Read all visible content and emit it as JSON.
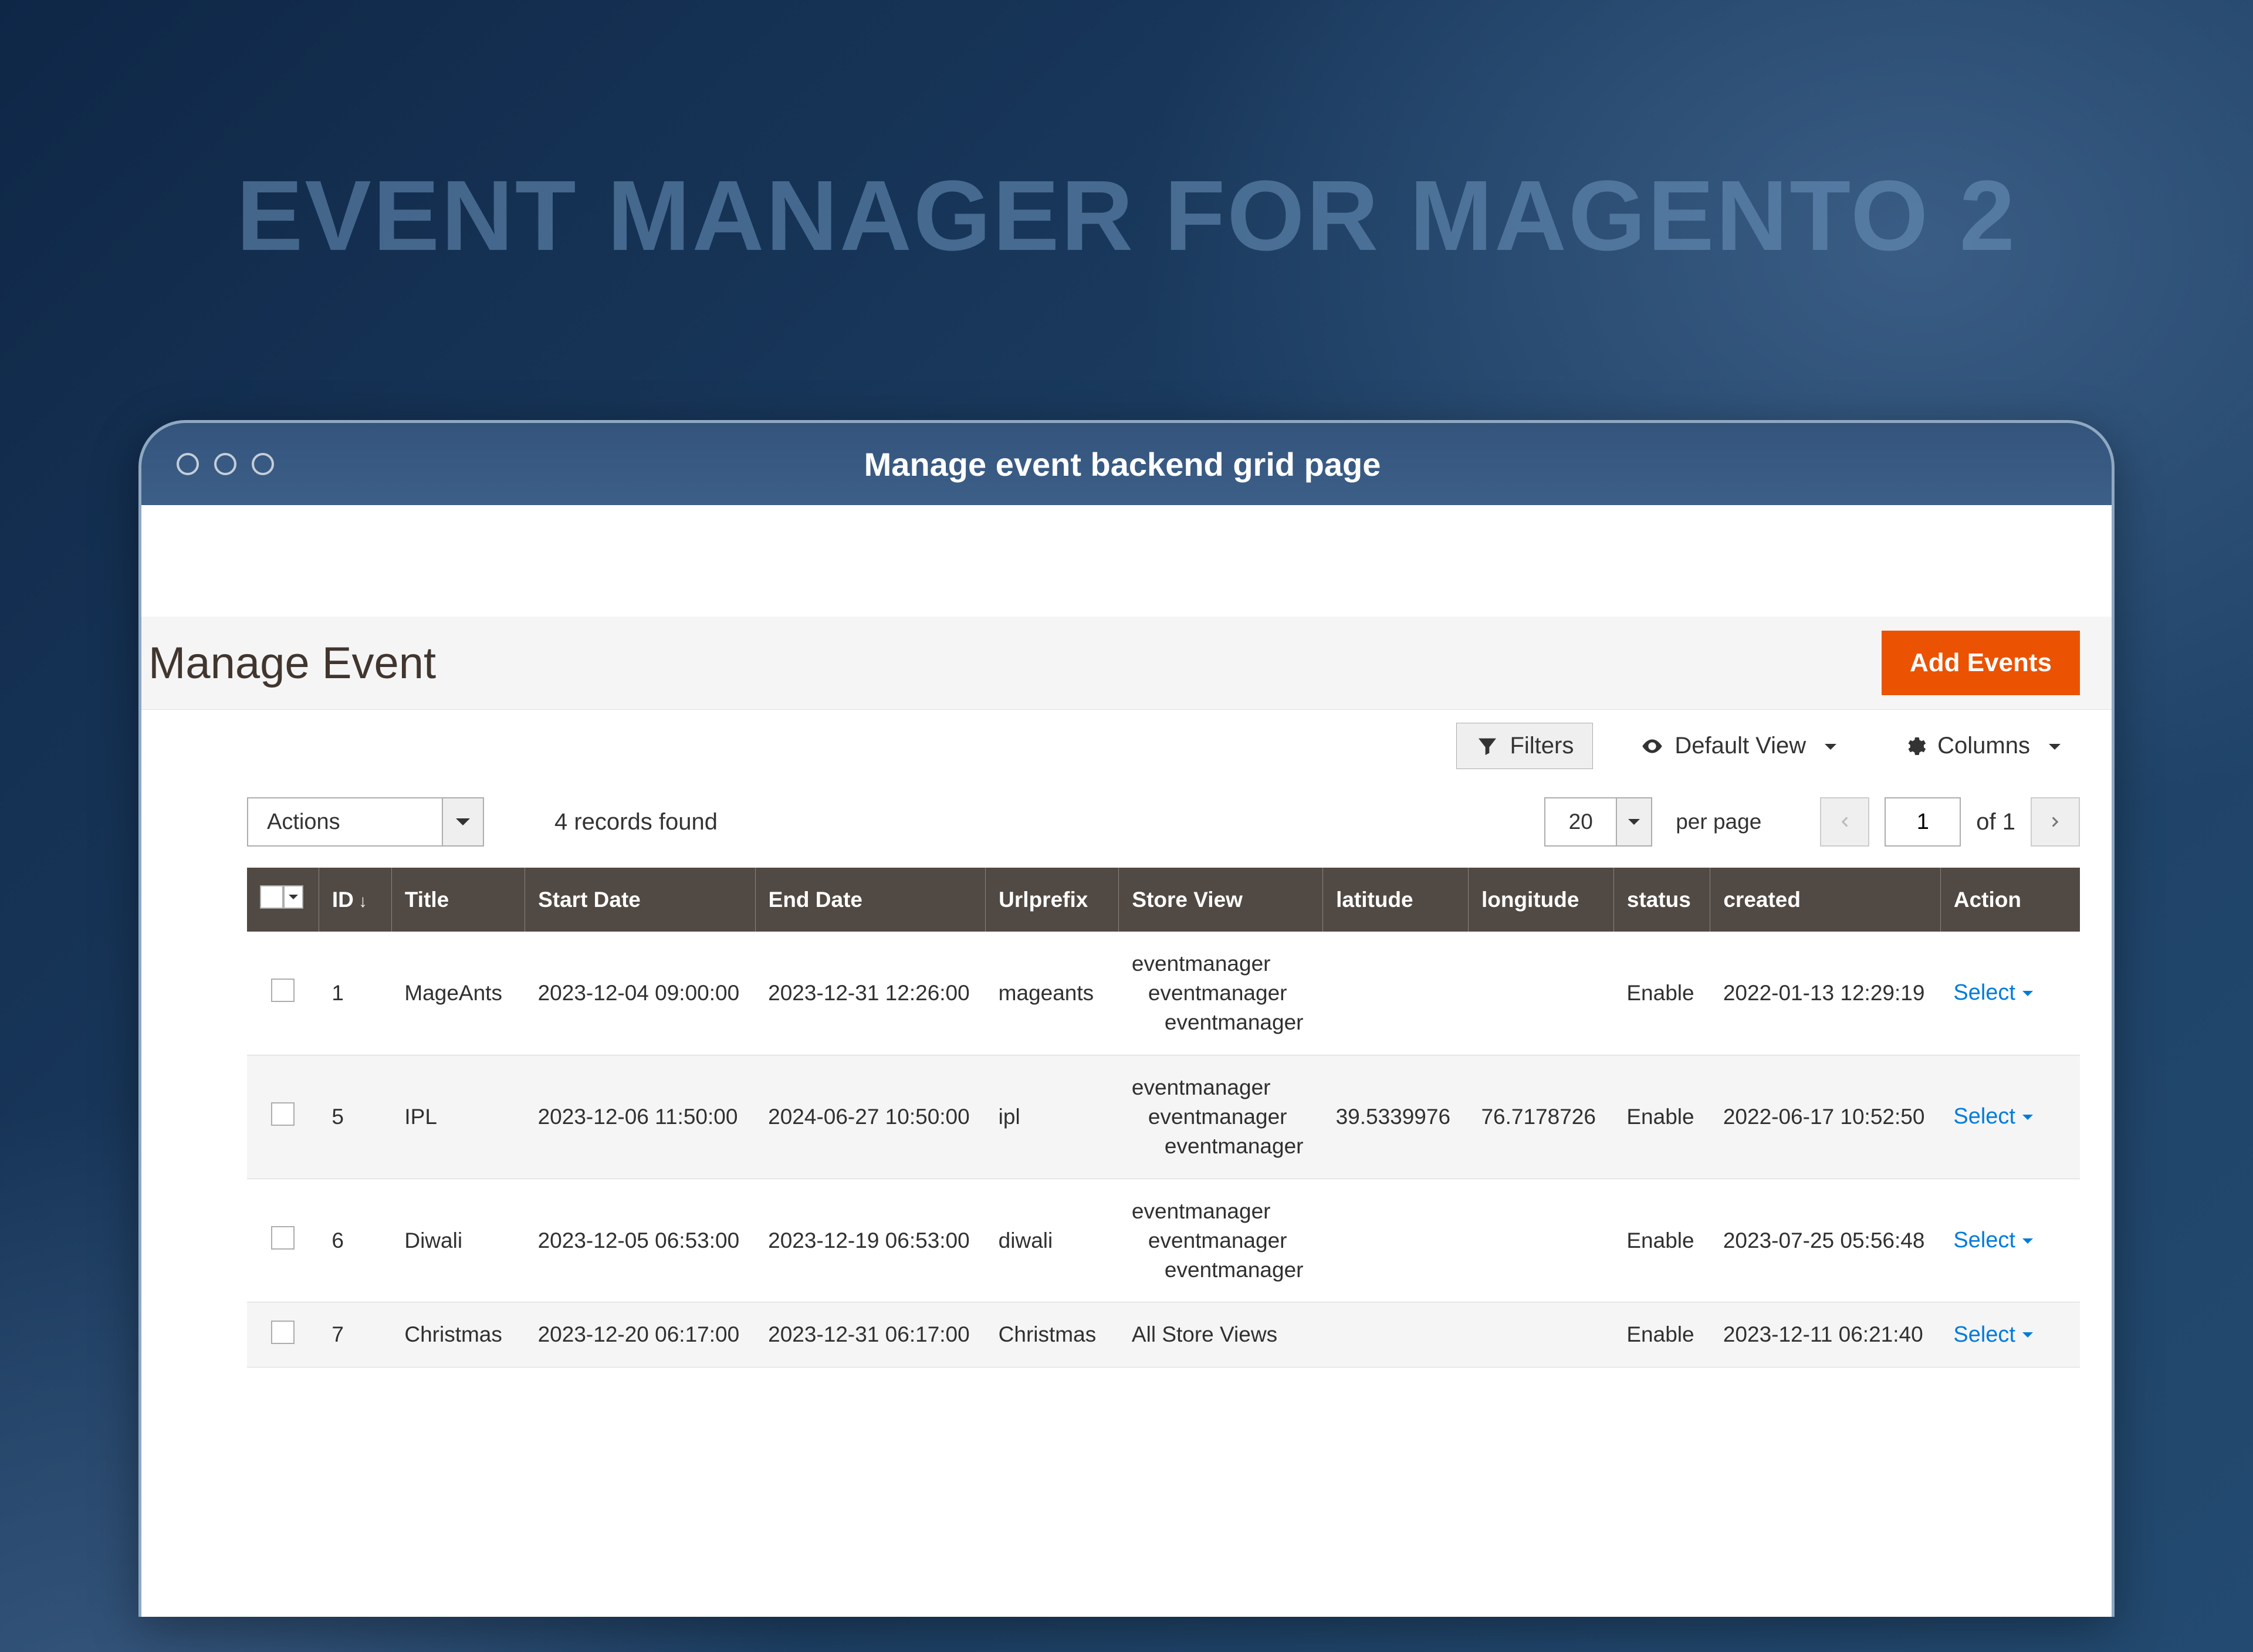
{
  "hero": "EVENT MANAGER FOR MAGENTO 2",
  "frame_title": "Manage event backend grid page",
  "page": {
    "title": "Manage Event",
    "add_button": "Add Events"
  },
  "toolbar": {
    "filters": "Filters",
    "default_view": "Default View",
    "columns": "Columns",
    "actions": "Actions",
    "records_found": "4 records found",
    "per_page_value": "20",
    "per_page_label": "per page",
    "page_current": "1",
    "page_of": "of 1"
  },
  "columns": {
    "id": "ID",
    "title": "Title",
    "start_date": "Start Date",
    "end_date": "End Date",
    "urlprefix": "Urlprefix",
    "store_view": "Store View",
    "latitude": "latitude",
    "longitude": "longitude",
    "status": "status",
    "created": "created",
    "action": "Action"
  },
  "action_label": "Select",
  "rows": [
    {
      "id": "1",
      "title": "MageAnts",
      "start": "2023-12-04 09:00:00",
      "end": "2023-12-31 12:26:00",
      "url": "mageants",
      "sv": [
        "eventmanager",
        "eventmanager",
        "eventmanager"
      ],
      "lat": "",
      "lng": "",
      "status": "Enable",
      "created": "2022-01-13 12:29:19"
    },
    {
      "id": "5",
      "title": "IPL",
      "start": "2023-12-06 11:50:00",
      "end": "2024-06-27 10:50:00",
      "url": "ipl",
      "sv": [
        "eventmanager",
        "eventmanager",
        "eventmanager"
      ],
      "lat": "39.5339976",
      "lng": "76.7178726",
      "status": "Enable",
      "created": "2022-06-17 10:52:50"
    },
    {
      "id": "6",
      "title": "Diwali",
      "start": "2023-12-05 06:53:00",
      "end": "2023-12-19 06:53:00",
      "url": "diwali",
      "sv": [
        "eventmanager",
        "eventmanager",
        "eventmanager"
      ],
      "lat": "",
      "lng": "",
      "status": "Enable",
      "created": "2023-07-25 05:56:48"
    },
    {
      "id": "7",
      "title": "Christmas",
      "start": "2023-12-20 06:17:00",
      "end": "2023-12-31 06:17:00",
      "url": "Christmas",
      "sv": [
        "All Store Views"
      ],
      "lat": "",
      "lng": "",
      "status": "Enable",
      "created": "2023-12-11 06:21:40"
    }
  ]
}
